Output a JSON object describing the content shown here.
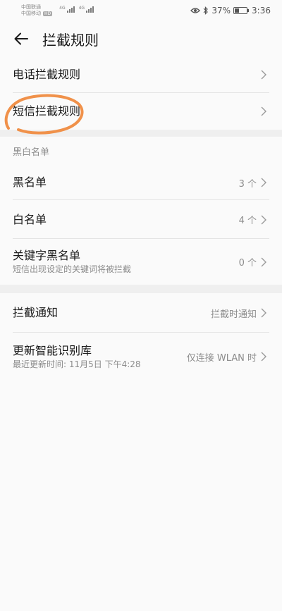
{
  "status_bar": {
    "carrier1": "中国联通",
    "carrier2": "中国移动",
    "hd": "HD",
    "net1": "4G",
    "net2": "4G",
    "battery_percent": "37%",
    "battery_level": 0.37,
    "time": "3:36",
    "eye_icon": "eye-icon",
    "bluetooth_icon": "bluetooth-icon"
  },
  "header": {
    "title": "拦截规则",
    "back_icon": "back-arrow-icon"
  },
  "rules": {
    "items": [
      {
        "label": "电话拦截规则"
      },
      {
        "label": "短信拦截规则"
      }
    ]
  },
  "lists": {
    "section_label": "黑白名单",
    "items": [
      {
        "label": "黑名单",
        "value": "3 个"
      },
      {
        "label": "白名单",
        "value": "4 个"
      },
      {
        "label": "关键字黑名单",
        "sub": "短信出现设定的关键词将被拦截",
        "value": "0 个"
      }
    ]
  },
  "settings": {
    "items": [
      {
        "label": "拦截通知",
        "value": "拦截时通知"
      },
      {
        "label": "更新智能识别库",
        "sub": "最近更新时间: 11月5日 下午4:28",
        "value": "仅连接 WLAN 时"
      }
    ]
  },
  "colors": {
    "annotation": "#f0914a",
    "background": "#fafafa",
    "divider": "#efefef"
  }
}
